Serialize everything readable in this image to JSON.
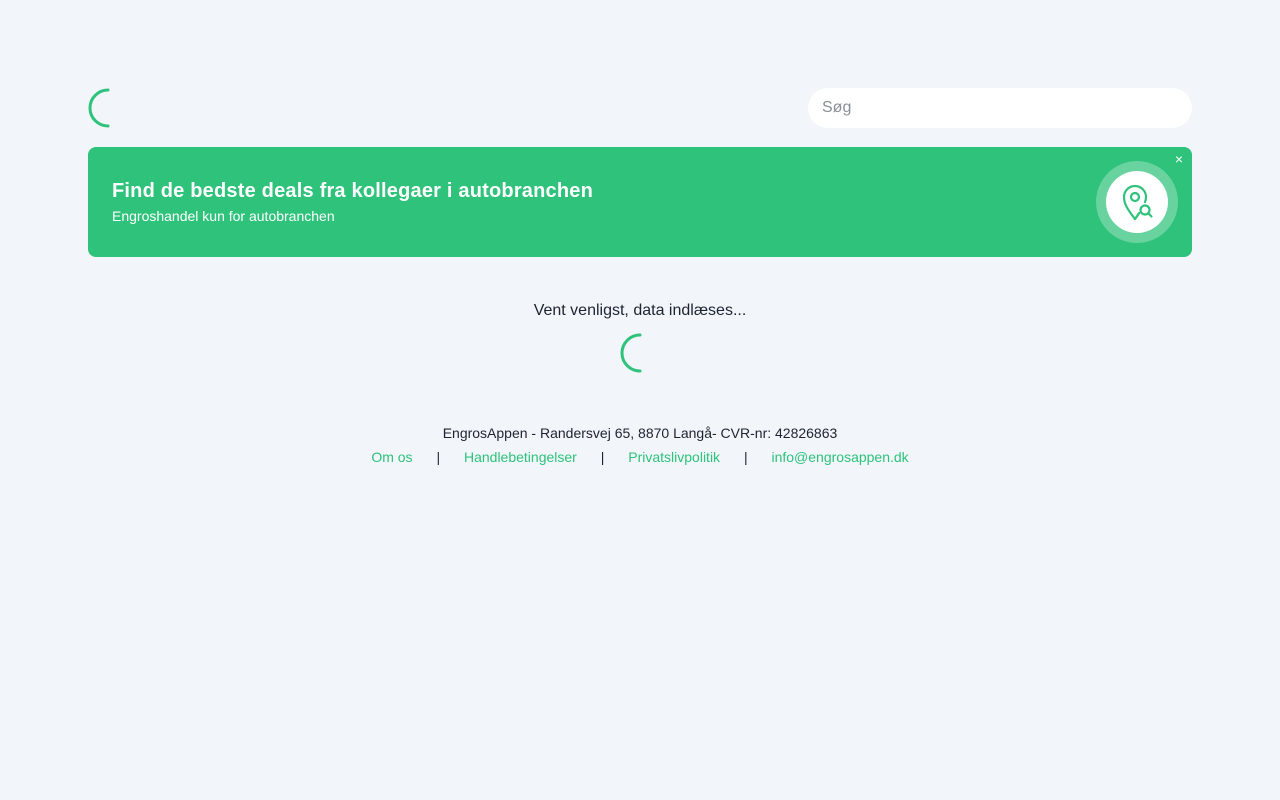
{
  "search": {
    "placeholder": "Søg",
    "value": ""
  },
  "banner": {
    "title": "Find de bedste deals fra kollegaer i autobranchen",
    "subtitle": "Engroshandel kun for autobranchen",
    "close_label": "×",
    "icon": "location-search-icon"
  },
  "loading": {
    "text": "Vent venligst, data indlæses..."
  },
  "footer": {
    "address": "EngrosAppen - Randersvej 65, 8870 Langå- CVR-nr: 42826863",
    "links": [
      {
        "label": "Om os"
      },
      {
        "label": "Handlebetingelser"
      },
      {
        "label": "Privatslivpolitik"
      },
      {
        "label": "info@engrosappen.dk"
      }
    ],
    "separator": "|"
  },
  "colors": {
    "accent": "#2ec27a",
    "background": "#f2f6fb",
    "text": "#1d2330"
  }
}
